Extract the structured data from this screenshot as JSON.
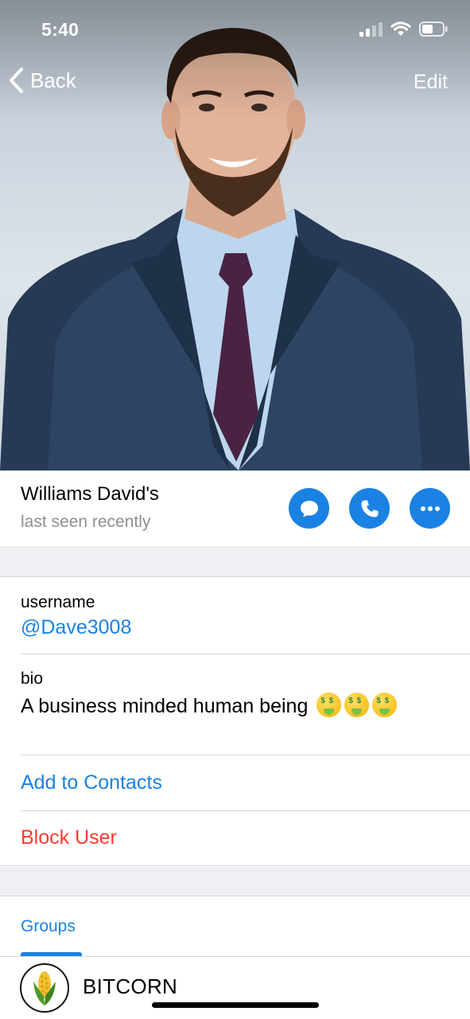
{
  "status_bar": {
    "time": "5:40"
  },
  "nav": {
    "back_label": "Back",
    "edit_label": "Edit"
  },
  "profile": {
    "name": "Williams David's",
    "last_seen": "last seen recently"
  },
  "actions": {
    "message_icon": "message-icon",
    "call_icon": "phone-icon",
    "more_icon": "more-icon"
  },
  "info": {
    "username_label": "username",
    "username_value": "@Dave3008",
    "bio_label": "bio",
    "bio_value": "A business minded human being",
    "bio_emojis": [
      "money-mouth-face-emoji",
      "money-mouth-face-emoji",
      "money-mouth-face-emoji"
    ],
    "add_contacts_label": "Add to Contacts",
    "block_user_label": "Block User"
  },
  "groups": {
    "tab_label": "Groups",
    "items": [
      {
        "name": "BITCORN",
        "icon": "corn-icon"
      }
    ]
  },
  "colors": {
    "accent": "#1a82e2",
    "danger": "#ff3b30",
    "secondary_text": "#8e8e93",
    "separator_bg": "#efeff4"
  }
}
